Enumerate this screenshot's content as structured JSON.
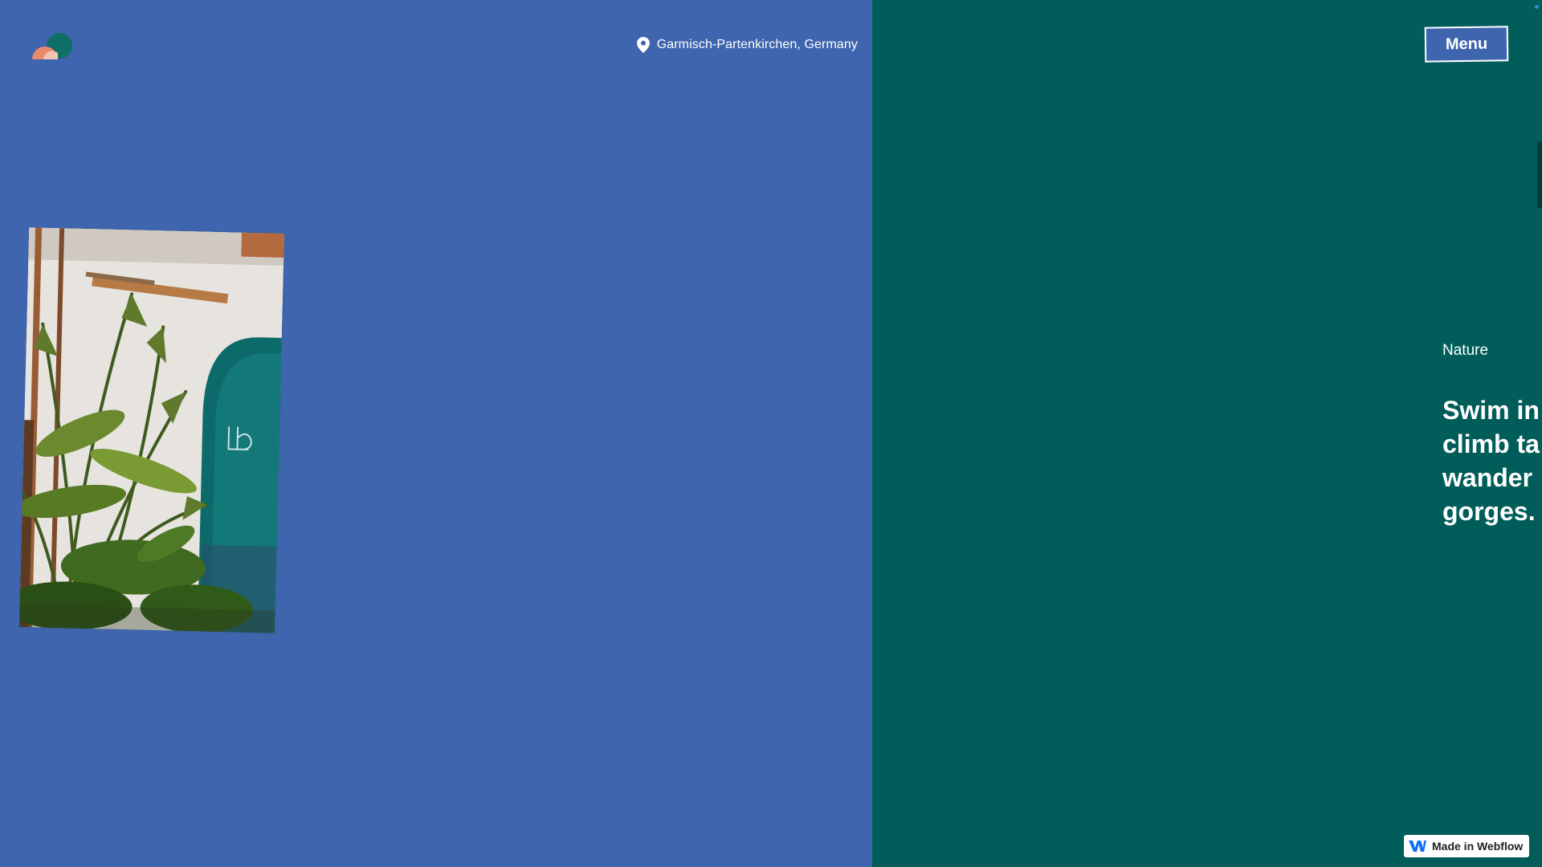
{
  "header": {
    "location": "Garmisch-Partenkirchen, Germany",
    "menu_label": "Menu"
  },
  "feature": {
    "category": "Nature",
    "headline_lines": [
      "Swim in",
      "climb ta",
      "wander",
      "gorges."
    ]
  },
  "badge": {
    "label": "Made in Webflow"
  },
  "colors": {
    "left_panel": "#3e65ad",
    "right_panel": "#015d5a",
    "logo_orange": "#e98a6a",
    "logo_teal": "#0f6f66"
  },
  "icons": [
    "location-pin-icon",
    "webflow-logo-icon",
    "brand-logo"
  ]
}
